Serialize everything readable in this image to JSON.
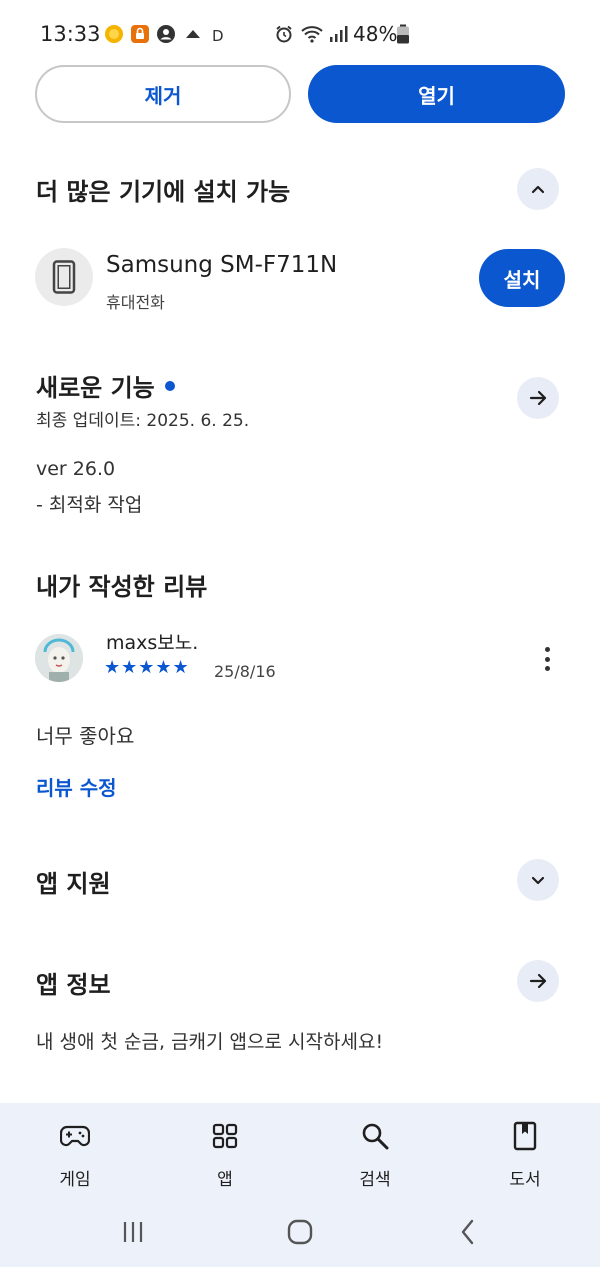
{
  "status_bar": {
    "time": "13:33",
    "indicator_letter": "D",
    "battery_percent": "48%"
  },
  "actions": {
    "remove_label": "제거",
    "open_label": "열기"
  },
  "more_devices": {
    "title": "더 많은 기기에 설치 가능",
    "device_name": "Samsung SM-F711N",
    "device_type": "휴대전화",
    "install_label": "설치"
  },
  "whats_new": {
    "title": "새로운 기능",
    "last_updated": "최종 업데이트: 2025. 6. 25.",
    "version": "ver 26.0",
    "note": "- 최적화 작업"
  },
  "my_review": {
    "title": "내가 작성한 리뷰",
    "reviewer": "maxs보노.",
    "rating": 5,
    "stars": "★★★★★",
    "date": "25/8/16",
    "text": "너무 좋아요",
    "edit_label": "리뷰 수정"
  },
  "app_support": {
    "title": "앱 지원"
  },
  "app_info": {
    "title": "앱 정보",
    "description": "내 생애 첫 순금, 금캐기 앱으로 시작하세요!"
  },
  "bottom_nav": {
    "items": [
      {
        "label": "게임",
        "icon": "gamepad-icon"
      },
      {
        "label": "앱",
        "icon": "apps-grid-icon"
      },
      {
        "label": "검색",
        "icon": "search-icon"
      },
      {
        "label": "도서",
        "icon": "book-icon"
      }
    ]
  },
  "colors": {
    "accent": "#0b57d0",
    "nav_background": "#edf1f9",
    "round_button": "#e8ecf7"
  }
}
